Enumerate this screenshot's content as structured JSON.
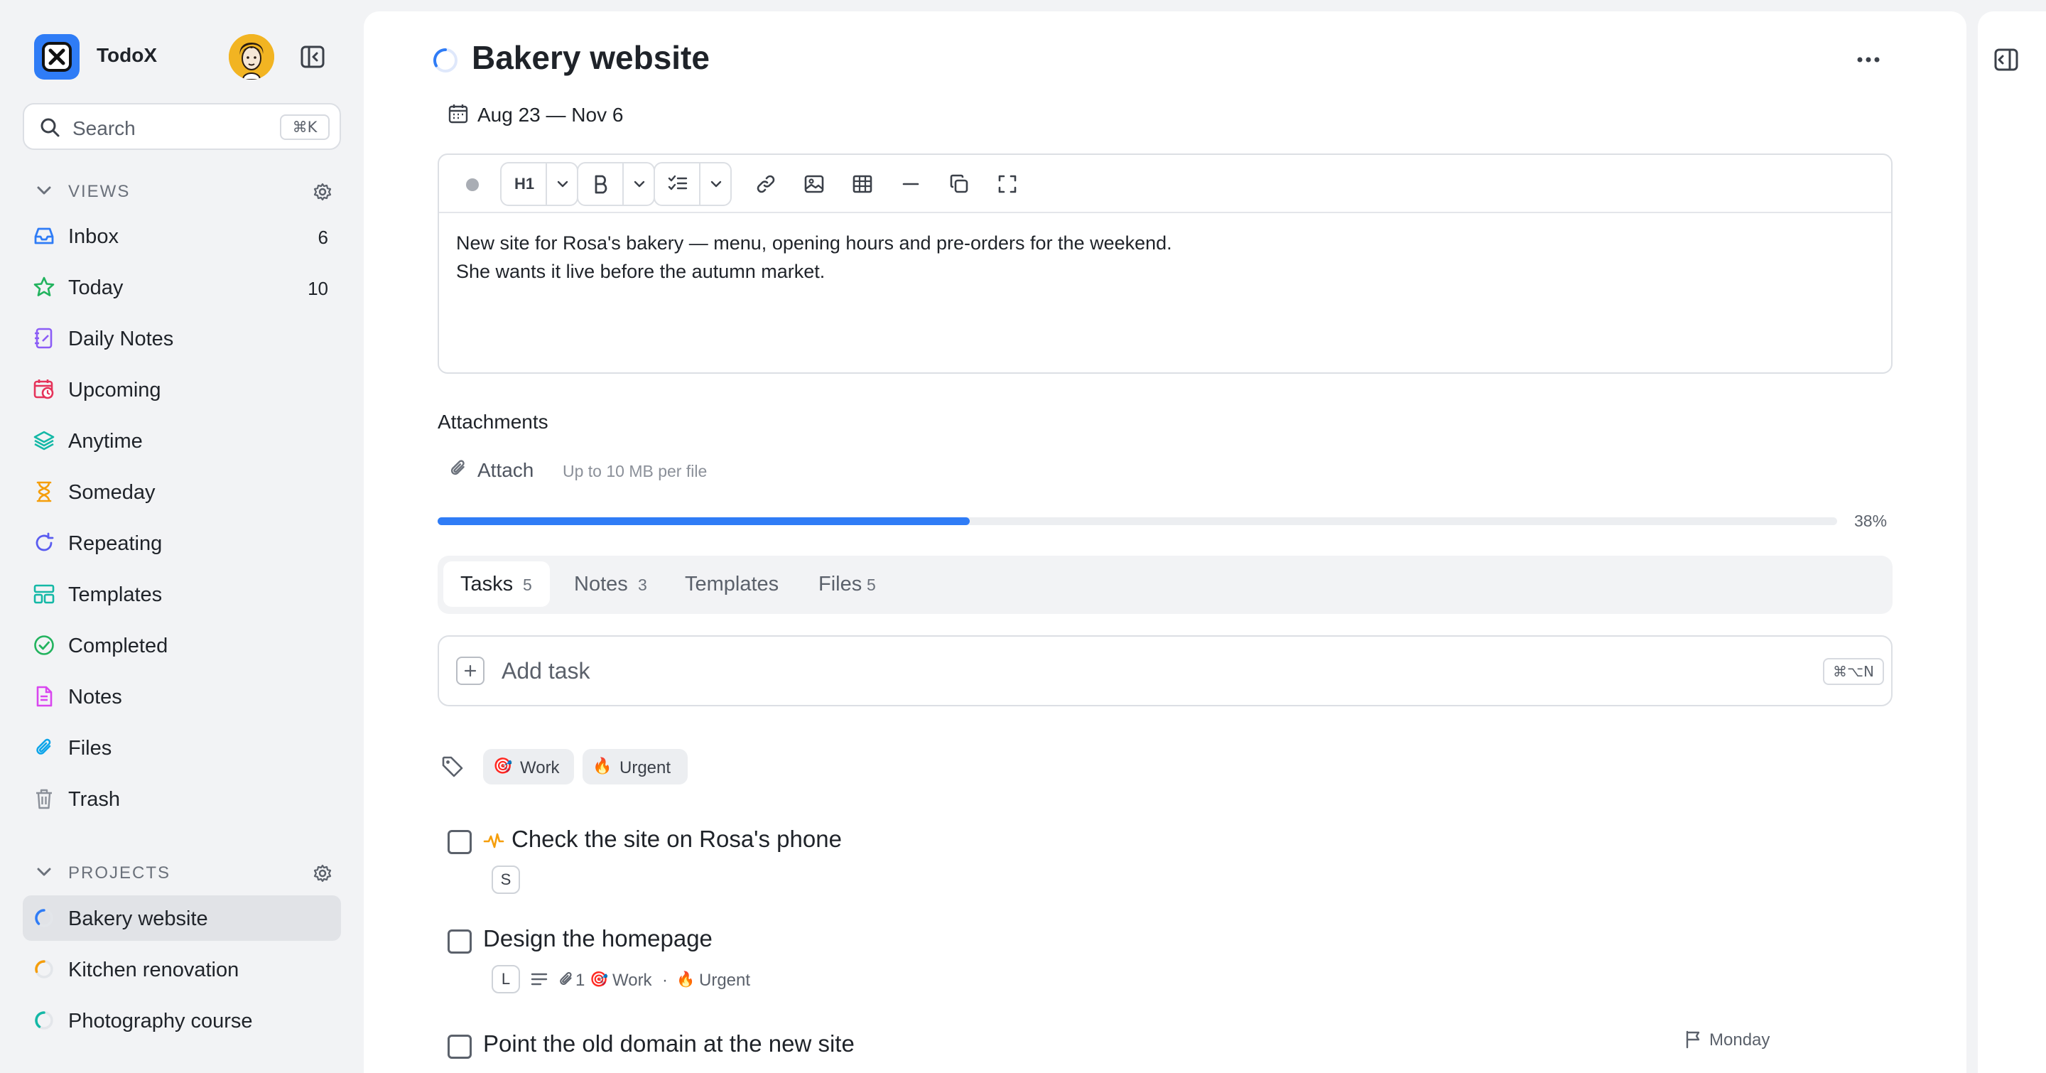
{
  "app": {
    "name": "TodoX"
  },
  "search": {
    "label": "Search",
    "shortcut": "⌘K"
  },
  "views": {
    "heading": "VIEWS",
    "items": [
      {
        "label": "Inbox",
        "count": "6",
        "icon": "inbox-icon",
        "color": "#2f7cf6"
      },
      {
        "label": "Today",
        "count": "10",
        "icon": "star-icon",
        "color": "#22b35e"
      },
      {
        "label": "Daily Notes",
        "count": "",
        "icon": "notebook-icon",
        "color": "#8b5cf6"
      },
      {
        "label": "Upcoming",
        "count": "",
        "icon": "calendar-clock-icon",
        "color": "#e5335a"
      },
      {
        "label": "Anytime",
        "count": "",
        "icon": "layers-icon",
        "color": "#14b8a6"
      },
      {
        "label": "Someday",
        "count": "",
        "icon": "hourglass-icon",
        "color": "#f59e0b"
      },
      {
        "label": "Repeating",
        "count": "",
        "icon": "repeat-icon",
        "color": "#5a5cf0"
      },
      {
        "label": "Templates",
        "count": "",
        "icon": "templates-icon",
        "color": "#14b8a6"
      },
      {
        "label": "Completed",
        "count": "",
        "icon": "check-circle-icon",
        "color": "#22b35e"
      },
      {
        "label": "Notes",
        "count": "",
        "icon": "note-icon",
        "color": "#d946ef"
      },
      {
        "label": "Files",
        "count": "",
        "icon": "paperclip-icon",
        "color": "#0ea5e9"
      },
      {
        "label": "Trash",
        "count": "",
        "icon": "trash-icon",
        "color": "#8b9099"
      }
    ]
  },
  "projects": {
    "heading": "PROJECTS",
    "items": [
      {
        "label": "Bakery website",
        "color": "#2f7cf6",
        "progress": 0.38,
        "active": true
      },
      {
        "label": "Kitchen renovation",
        "color": "#f59e0b",
        "progress": 0.3,
        "active": false
      },
      {
        "label": "Photography course",
        "color": "#14b8a6",
        "progress": 0.4,
        "active": false
      }
    ]
  },
  "project": {
    "title": "Bakery website",
    "dates": "Aug 23 — Nov 6",
    "description_line1": "New site for Rosa's bakery — menu, opening hours and pre-orders for the weekend.",
    "description_line2": "She wants it live before the autumn market.",
    "heading_button": "H1",
    "attachments_title": "Attachments",
    "attach_label": "Attach",
    "attach_hint": "Up to 10 MB per file",
    "progress": 0.38,
    "progress_label": "38%"
  },
  "tabs": [
    {
      "label": "Tasks",
      "count": "5",
      "active": true
    },
    {
      "label": "Notes",
      "count": "3",
      "active": false
    },
    {
      "label": "Templates",
      "count": "",
      "active": false
    },
    {
      "label": "Files",
      "count": "5",
      "active": false
    }
  ],
  "add_task": {
    "label": "Add task",
    "shortcut": "⌘⌥N"
  },
  "tag_filters": [
    {
      "label": "Work",
      "emoji": "🎯"
    },
    {
      "label": "Urgent",
      "emoji": "🔥"
    }
  ],
  "tasks": [
    {
      "title": "Check the site on Rosa's phone",
      "size": "S",
      "activity_icon": true
    },
    {
      "title": "Design the homepage",
      "size": "L",
      "attachments": "1",
      "tag1": "Work",
      "tag1_emoji": "🎯",
      "separator": "·",
      "tag2": "Urgent",
      "tag2_emoji": "🔥"
    },
    {
      "title": "Point the old domain at the new site",
      "due": "Monday"
    }
  ],
  "colors": {
    "accent": "#2f7cf6",
    "sidebar_bg": "#f2f3f5",
    "activity": "#f59e0b"
  }
}
